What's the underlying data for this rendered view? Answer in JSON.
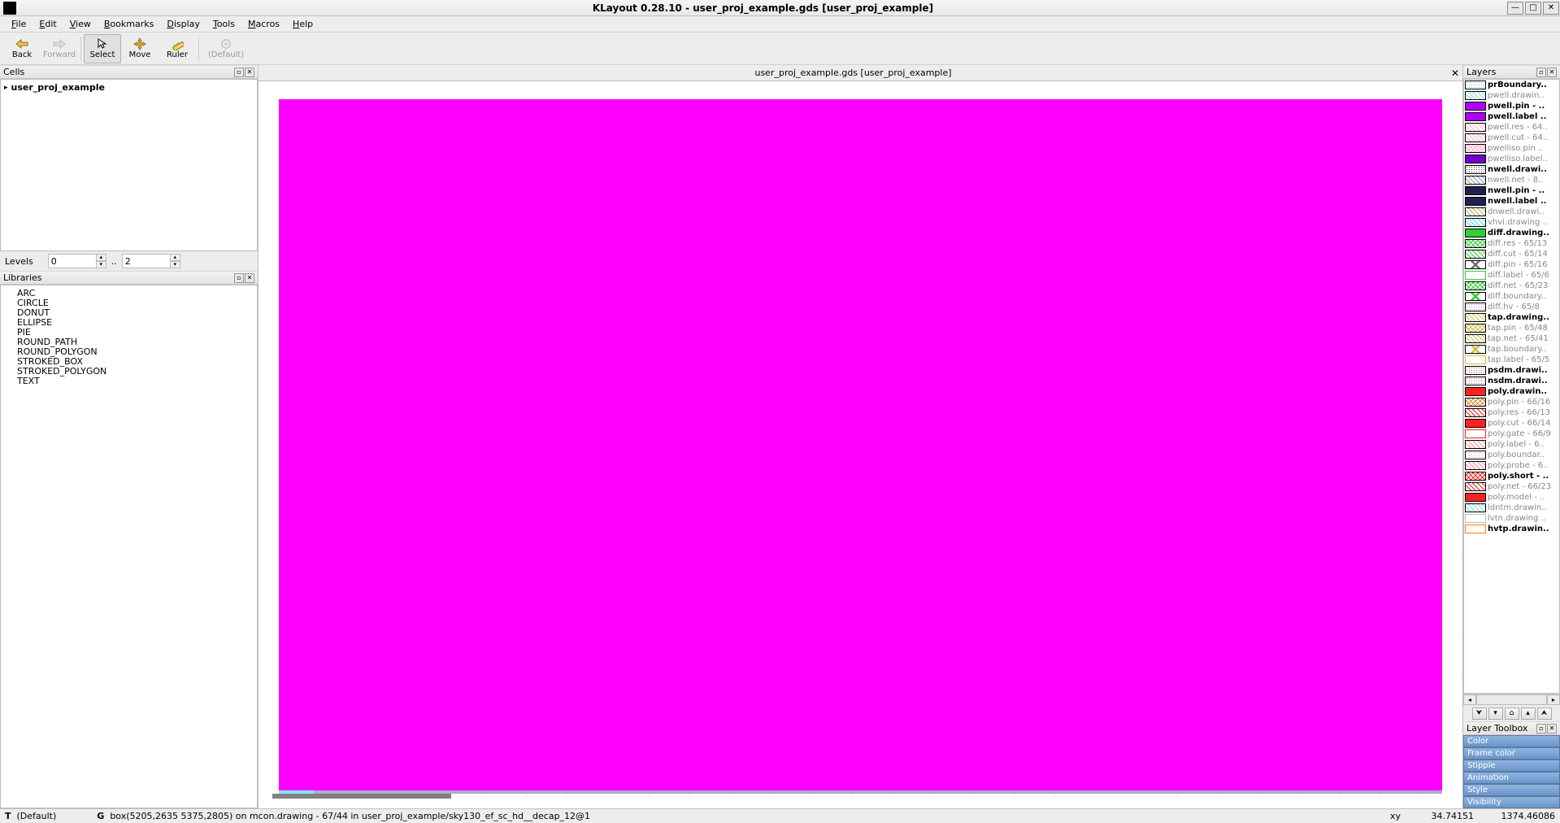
{
  "title": "KLayout 0.28.10 - user_proj_example.gds [user_proj_example]",
  "menu": [
    "File",
    "Edit",
    "View",
    "Bookmarks",
    "Display",
    "Tools",
    "Macros",
    "Help"
  ],
  "toolbar": {
    "back": "Back",
    "forward": "Forward",
    "select": "Select",
    "move": "Move",
    "ruler": "Ruler",
    "default": "(Default)"
  },
  "cells": {
    "title": "Cells",
    "root": "user_proj_example"
  },
  "levels": {
    "label": "Levels",
    "from": "0",
    "sep": "..",
    "to": "2"
  },
  "libraries": {
    "title": "Libraries",
    "items": [
      "ARC",
      "CIRCLE",
      "DONUT",
      "ELLIPSE",
      "PIE",
      "ROUND_PATH",
      "ROUND_POLYGON",
      "STROKED_BOX",
      "STROKED_POLYGON",
      "TEXT"
    ]
  },
  "tab": {
    "label": "user_proj_example.gds [user_proj_example]"
  },
  "layers": {
    "title": "Layers",
    "toolbox_title": "Layer Toolbox",
    "toolbox": [
      "Color",
      "Frame color",
      "Stipple",
      "Animation",
      "Style",
      "Visibility"
    ],
    "rows": [
      {
        "name": "prBoundary..",
        "bold": true,
        "pat": "dots",
        "color": "#88c4e8"
      },
      {
        "name": "pwell.drawin..",
        "bold": false,
        "pat": "hatch",
        "color": "#7fe0e0"
      },
      {
        "name": "pwell.pin - ..",
        "bold": true,
        "pat": "solid",
        "color": "#b000ff"
      },
      {
        "name": "pwell.label ..",
        "bold": true,
        "pat": "solid",
        "color": "#b000ff"
      },
      {
        "name": "pwell.res - 64..",
        "bold": false,
        "pat": "hatch",
        "color": "#ffb0d0"
      },
      {
        "name": "pwell.cut - 64..",
        "bold": false,
        "pat": "hatch",
        "color": "#ffb0d0"
      },
      {
        "name": "pwelliso.pin ..",
        "bold": false,
        "pat": "cross",
        "color": "#ffb0d0"
      },
      {
        "name": "pwelliso.label..",
        "bold": false,
        "pat": "solid",
        "color": "#7000d0"
      },
      {
        "name": "nwell.drawi..",
        "bold": true,
        "pat": "dots",
        "color": "#303060"
      },
      {
        "name": "nwell.net - 8..",
        "bold": false,
        "pat": "hatch",
        "color": "#9090b0"
      },
      {
        "name": "nwell.pin - ..",
        "bold": true,
        "pat": "solid",
        "color": "#202050"
      },
      {
        "name": "nwell.label ..",
        "bold": true,
        "pat": "solid",
        "color": "#202050"
      },
      {
        "name": "dnwell.drawi..",
        "bold": false,
        "pat": "hatch",
        "color": "#c0a860"
      },
      {
        "name": "vhvi.drawing ..",
        "bold": false,
        "pat": "hatch",
        "color": "#40e0ff"
      },
      {
        "name": "diff.drawing..",
        "bold": true,
        "pat": "solid",
        "color": "#30d030"
      },
      {
        "name": "diff.res - 65/13",
        "bold": false,
        "pat": "cross",
        "color": "#30d030"
      },
      {
        "name": "diff.cut - 65/14",
        "bold": false,
        "pat": "hatch",
        "color": "#30d030"
      },
      {
        "name": "diff.pin - 65/16",
        "bold": false,
        "pat": "x",
        "color": "#707070"
      },
      {
        "name": "diff.label - 65/6",
        "bold": false,
        "pat": "outline",
        "color": "#30d030"
      },
      {
        "name": "diff.net - 65/23",
        "bold": false,
        "pat": "cross",
        "color": "#30d030"
      },
      {
        "name": "diff.boundary..",
        "bold": false,
        "pat": "x",
        "color": "#30d030"
      },
      {
        "name": "diff.hv - 65/8",
        "bold": false,
        "pat": "dots",
        "color": "#c080ff"
      },
      {
        "name": "tap.drawing..",
        "bold": true,
        "pat": "hatch",
        "color": "#d0c040"
      },
      {
        "name": "tap.pin - 65/48",
        "bold": false,
        "pat": "cross",
        "color": "#d0c040"
      },
      {
        "name": "tap.net - 65/41",
        "bold": false,
        "pat": "hatch",
        "color": "#d0c040"
      },
      {
        "name": "tap.boundary..",
        "bold": false,
        "pat": "x",
        "color": "#d0c040"
      },
      {
        "name": "tap.label - 65/5",
        "bold": false,
        "pat": "outline",
        "color": "#d0c040"
      },
      {
        "name": "psdm.drawi..",
        "bold": true,
        "pat": "dots",
        "color": "#c06080"
      },
      {
        "name": "nsdm.drawi..",
        "bold": true,
        "pat": "dots",
        "color": "#ff6060"
      },
      {
        "name": "poly.drawin..",
        "bold": true,
        "pat": "solid",
        "color": "#ff2020"
      },
      {
        "name": "poly.pin - 66/16",
        "bold": false,
        "pat": "cross",
        "color": "#e09030"
      },
      {
        "name": "poly.res - 66/13",
        "bold": false,
        "pat": "hatch",
        "color": "#ff2020"
      },
      {
        "name": "poly.cut - 66/14",
        "bold": false,
        "pat": "solid",
        "color": "#ff2020"
      },
      {
        "name": "poly.gate - 66/9",
        "bold": false,
        "pat": "outline",
        "color": "#ff2020"
      },
      {
        "name": "poly.label - 6..",
        "bold": false,
        "pat": "hatch",
        "color": "#ff9090"
      },
      {
        "name": "poly.boundar..",
        "bold": false,
        "pat": "dots",
        "color": "#ff9090"
      },
      {
        "name": "poly.probe - 6..",
        "bold": false,
        "pat": "hatch",
        "color": "#ff9090"
      },
      {
        "name": "poly.short - ..",
        "bold": true,
        "pat": "cross",
        "color": "#ff2020"
      },
      {
        "name": "poly.net - 66/23",
        "bold": false,
        "pat": "hatch",
        "color": "#ff2020"
      },
      {
        "name": "poly.model - ..",
        "bold": false,
        "pat": "solid",
        "color": "#ff2020"
      },
      {
        "name": "ldntm.drawin..",
        "bold": false,
        "pat": "hatch",
        "color": "#80e0d0"
      },
      {
        "name": "lvtn.drawing ..",
        "bold": false,
        "pat": "outline",
        "color": "#c0c0c0"
      },
      {
        "name": "hvtp.drawin..",
        "bold": true,
        "pat": "outline",
        "color": "#ff8000"
      }
    ]
  },
  "status": {
    "t": "T",
    "default": "(Default)",
    "g": "G",
    "info": "box(5205,2635 5375,2805) on mcon.drawing - 67/44 in user_proj_example/sky130_ef_sc_hd__decap_12@1",
    "xy_label": "xy",
    "x": "34.74151",
    "y": "1374.46086"
  }
}
